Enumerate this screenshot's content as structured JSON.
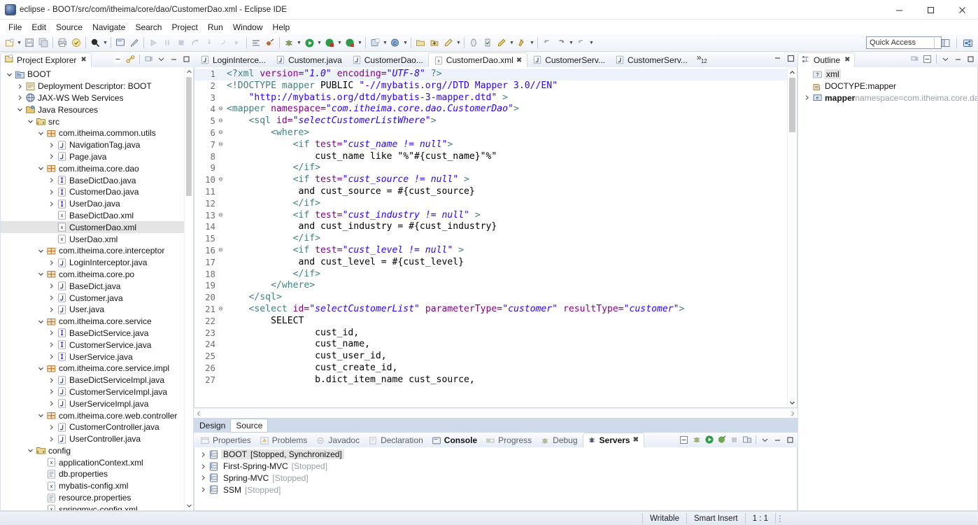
{
  "window": {
    "title": "eclipse - BOOT/src/com/itheima/core/dao/CustomerDao.xml - Eclipse IDE",
    "minimize": "─",
    "maximize": "□",
    "close": "✕"
  },
  "menubar": {
    "items": [
      "File",
      "Edit",
      "Source",
      "Navigate",
      "Search",
      "Project",
      "Run",
      "Window",
      "Help"
    ]
  },
  "toolbar": {
    "quick_access": "Quick Access"
  },
  "project_explorer": {
    "title": "Project Explorer",
    "close_mark": "✖",
    "tree": [
      {
        "indent": 0,
        "twisty": "down",
        "icon": "project-icon",
        "label": "BOOT",
        "selected": false
      },
      {
        "indent": 1,
        "twisty": "right",
        "icon": "deployment-icon",
        "label": "Deployment Descriptor: BOOT",
        "selected": false
      },
      {
        "indent": 1,
        "twisty": "right",
        "icon": "webservice-icon",
        "label": "JAX-WS Web Services",
        "selected": false
      },
      {
        "indent": 1,
        "twisty": "down",
        "icon": "javaresources-icon",
        "label": "Java Resources",
        "selected": false
      },
      {
        "indent": 2,
        "twisty": "down",
        "icon": "sourcefolder-icon",
        "label": "src",
        "selected": false
      },
      {
        "indent": 3,
        "twisty": "down",
        "icon": "package-icon",
        "label": "com.itheima.common.utils",
        "selected": false
      },
      {
        "indent": 4,
        "twisty": "right",
        "icon": "java-class-icon",
        "label": "NavigationTag.java",
        "selected": false
      },
      {
        "indent": 4,
        "twisty": "right",
        "icon": "java-class-icon",
        "label": "Page.java",
        "selected": false
      },
      {
        "indent": 3,
        "twisty": "down",
        "icon": "package-icon",
        "label": "com.itheima.core.dao",
        "selected": false
      },
      {
        "indent": 4,
        "twisty": "right",
        "icon": "java-interface-icon",
        "label": "BaseDictDao.java",
        "selected": false
      },
      {
        "indent": 4,
        "twisty": "right",
        "icon": "java-interface-icon",
        "label": "CustomerDao.java",
        "selected": false
      },
      {
        "indent": 4,
        "twisty": "right",
        "icon": "java-interface-icon",
        "label": "UserDao.java",
        "selected": false
      },
      {
        "indent": 4,
        "twisty": "none",
        "icon": "xml-file-icon",
        "label": "BaseDictDao.xml",
        "selected": false
      },
      {
        "indent": 4,
        "twisty": "none",
        "icon": "xml-file-icon",
        "label": "CustomerDao.xml",
        "selected": true
      },
      {
        "indent": 4,
        "twisty": "none",
        "icon": "xml-file-icon",
        "label": "UserDao.xml",
        "selected": false
      },
      {
        "indent": 3,
        "twisty": "down",
        "icon": "package-icon",
        "label": "com.itheima.core.interceptor",
        "selected": false
      },
      {
        "indent": 4,
        "twisty": "right",
        "icon": "java-class-icon",
        "label": "LoginInterceptor.java",
        "selected": false
      },
      {
        "indent": 3,
        "twisty": "down",
        "icon": "package-icon",
        "label": "com.itheima.core.po",
        "selected": false
      },
      {
        "indent": 4,
        "twisty": "right",
        "icon": "java-class-icon",
        "label": "BaseDict.java",
        "selected": false
      },
      {
        "indent": 4,
        "twisty": "right",
        "icon": "java-class-icon",
        "label": "Customer.java",
        "selected": false
      },
      {
        "indent": 4,
        "twisty": "right",
        "icon": "java-class-icon",
        "label": "User.java",
        "selected": false
      },
      {
        "indent": 3,
        "twisty": "down",
        "icon": "package-icon",
        "label": "com.itheima.core.service",
        "selected": false
      },
      {
        "indent": 4,
        "twisty": "right",
        "icon": "java-interface-icon",
        "label": "BaseDictService.java",
        "selected": false
      },
      {
        "indent": 4,
        "twisty": "right",
        "icon": "java-interface-icon",
        "label": "CustomerService.java",
        "selected": false
      },
      {
        "indent": 4,
        "twisty": "right",
        "icon": "java-interface-icon",
        "label": "UserService.java",
        "selected": false
      },
      {
        "indent": 3,
        "twisty": "down",
        "icon": "package-icon",
        "label": "com.itheima.core.service.impl",
        "selected": false
      },
      {
        "indent": 4,
        "twisty": "right",
        "icon": "java-class-icon",
        "label": "BaseDictServiceImpl.java",
        "selected": false
      },
      {
        "indent": 4,
        "twisty": "right",
        "icon": "java-class-icon",
        "label": "CustomerServiceImpl.java",
        "selected": false
      },
      {
        "indent": 4,
        "twisty": "right",
        "icon": "java-class-icon",
        "label": "UserServiceImpl.java",
        "selected": false
      },
      {
        "indent": 3,
        "twisty": "down",
        "icon": "package-icon",
        "label": "com.itheima.core.web.controller",
        "selected": false
      },
      {
        "indent": 4,
        "twisty": "right",
        "icon": "java-class-icon",
        "label": "CustomerController.java",
        "selected": false
      },
      {
        "indent": 4,
        "twisty": "right",
        "icon": "java-class-icon",
        "label": "UserController.java",
        "selected": false
      },
      {
        "indent": 2,
        "twisty": "down",
        "icon": "sourcefolder-icon",
        "label": "config",
        "selected": false
      },
      {
        "indent": 3,
        "twisty": "none",
        "icon": "xml-file-icon",
        "label": "applicationContext.xml",
        "selected": false
      },
      {
        "indent": 3,
        "twisty": "none",
        "icon": "properties-file-icon",
        "label": "db.properties",
        "selected": false
      },
      {
        "indent": 3,
        "twisty": "none",
        "icon": "xml-file-icon",
        "label": "mybatis-config.xml",
        "selected": false
      },
      {
        "indent": 3,
        "twisty": "none",
        "icon": "properties-file-icon",
        "label": "resource.properties",
        "selected": false
      },
      {
        "indent": 3,
        "twisty": "none",
        "icon": "xml-file-icon",
        "label": "springmvc-config.xml",
        "selected": false
      }
    ]
  },
  "editor": {
    "tabs": [
      {
        "label": "LoginIntercе...",
        "icon": "java-class-icon",
        "active": false
      },
      {
        "label": "Customer.java",
        "icon": "java-class-icon",
        "active": false
      },
      {
        "label": "CustomerDao...",
        "icon": "java-class-icon",
        "active": false
      },
      {
        "label": "CustomerDao.xml",
        "icon": "xml-file-icon",
        "active": true
      },
      {
        "label": "CustomerServ...",
        "icon": "java-class-icon",
        "active": false
      },
      {
        "label": "CustomerServ...",
        "icon": "java-class-icon",
        "active": false
      }
    ],
    "overflow_symbol": "»",
    "overflow_count": "12",
    "close_mark": "✖",
    "bottom_tabs": [
      {
        "label": "Design",
        "active": false
      },
      {
        "label": "Source",
        "active": true
      }
    ],
    "lines": [
      {
        "n": "1",
        "fold": "",
        "current": true,
        "parts": [
          {
            "t": "<?xml ",
            "c": "k-pi"
          },
          {
            "t": "version=",
            "c": "k-attr"
          },
          {
            "t": "\"1.0\"",
            "c": "k-str"
          },
          {
            "t": " ",
            "c": "k-txt"
          },
          {
            "t": "encoding=",
            "c": "k-attr"
          },
          {
            "t": "\"UTF-8\"",
            "c": "k-str"
          },
          {
            "t": " ?>",
            "c": "k-pi"
          }
        ]
      },
      {
        "n": "2",
        "fold": "",
        "parts": [
          {
            "t": "<!DOCTYPE mapper ",
            "c": "k-doct"
          },
          {
            "t": "PUBLIC ",
            "c": "k-txt"
          },
          {
            "t": "\"-//mybatis.org//DTD Mapper 3.0//EN\"",
            "c": "k-strp"
          }
        ]
      },
      {
        "n": "3",
        "fold": "",
        "parts": [
          {
            "t": "    ",
            "c": "k-txt"
          },
          {
            "t": "\"http://mybatis.org/dtd/mybatis-3-mapper.dtd\"",
            "c": "k-strp"
          },
          {
            "t": " >",
            "c": "k-doct"
          }
        ]
      },
      {
        "n": "4",
        "fold": "⊖",
        "parts": [
          {
            "t": "<mapper ",
            "c": "k-tag"
          },
          {
            "t": "namespace=",
            "c": "k-attr"
          },
          {
            "t": "\"com.itheima.core.dao.CustomerDao\"",
            "c": "k-str"
          },
          {
            "t": ">",
            "c": "k-tag"
          }
        ]
      },
      {
        "n": "5",
        "fold": "⊖",
        "parts": [
          {
            "t": "    <sql ",
            "c": "k-tag"
          },
          {
            "t": "id=",
            "c": "k-attr"
          },
          {
            "t": "\"selectCustomerListWhere\"",
            "c": "k-str"
          },
          {
            "t": ">",
            "c": "k-tag"
          }
        ]
      },
      {
        "n": "6",
        "fold": "⊖",
        "parts": [
          {
            "t": "        <where>",
            "c": "k-tag"
          }
        ]
      },
      {
        "n": "7",
        "fold": "⊖",
        "parts": [
          {
            "t": "            <if ",
            "c": "k-tag"
          },
          {
            "t": "test=",
            "c": "k-attr"
          },
          {
            "t": "\"cust_name != null\"",
            "c": "k-str"
          },
          {
            "t": ">",
            "c": "k-tag"
          }
        ]
      },
      {
        "n": "8",
        "fold": "",
        "parts": [
          {
            "t": "                cust_name like \"%\"#{cust_name}\"%\"",
            "c": "k-txt"
          }
        ]
      },
      {
        "n": "9",
        "fold": "",
        "parts": [
          {
            "t": "            </if>",
            "c": "k-tag"
          }
        ]
      },
      {
        "n": "10",
        "fold": "⊖",
        "parts": [
          {
            "t": "            <if ",
            "c": "k-tag"
          },
          {
            "t": "test=",
            "c": "k-attr"
          },
          {
            "t": "\"cust_source != null\"",
            "c": "k-str"
          },
          {
            "t": " >",
            "c": "k-tag"
          }
        ]
      },
      {
        "n": "11",
        "fold": "",
        "parts": [
          {
            "t": "             and cust_source = #{cust_source}",
            "c": "k-txt"
          }
        ]
      },
      {
        "n": "12",
        "fold": "",
        "parts": [
          {
            "t": "            </if>",
            "c": "k-tag"
          }
        ]
      },
      {
        "n": "13",
        "fold": "⊖",
        "parts": [
          {
            "t": "            <if ",
            "c": "k-tag"
          },
          {
            "t": "test=",
            "c": "k-attr"
          },
          {
            "t": "\"cust_industry != null\"",
            "c": "k-str"
          },
          {
            "t": " >",
            "c": "k-tag"
          }
        ]
      },
      {
        "n": "14",
        "fold": "",
        "parts": [
          {
            "t": "             and cust_industry = #{cust_industry}",
            "c": "k-txt"
          }
        ]
      },
      {
        "n": "15",
        "fold": "",
        "parts": [
          {
            "t": "            </if>",
            "c": "k-tag"
          }
        ]
      },
      {
        "n": "16",
        "fold": "⊖",
        "parts": [
          {
            "t": "            <if ",
            "c": "k-tag"
          },
          {
            "t": "test=",
            "c": "k-attr"
          },
          {
            "t": "\"cust_level != null\"",
            "c": "k-str"
          },
          {
            "t": " >",
            "c": "k-tag"
          }
        ]
      },
      {
        "n": "17",
        "fold": "",
        "parts": [
          {
            "t": "             and cust_level = #{cust_level}",
            "c": "k-txt"
          }
        ]
      },
      {
        "n": "18",
        "fold": "",
        "parts": [
          {
            "t": "            </if>",
            "c": "k-tag"
          }
        ]
      },
      {
        "n": "19",
        "fold": "",
        "parts": [
          {
            "t": "        </where>",
            "c": "k-tag"
          }
        ]
      },
      {
        "n": "20",
        "fold": "",
        "parts": [
          {
            "t": "    </sql>",
            "c": "k-tag"
          }
        ]
      },
      {
        "n": "21",
        "fold": "⊖",
        "parts": [
          {
            "t": "    <select ",
            "c": "k-tag"
          },
          {
            "t": "id=",
            "c": "k-attr"
          },
          {
            "t": "\"selectCustomerList\"",
            "c": "k-str"
          },
          {
            "t": " ",
            "c": "k-txt"
          },
          {
            "t": "parameterType=",
            "c": "k-attr"
          },
          {
            "t": "\"customer\"",
            "c": "k-str"
          },
          {
            "t": " ",
            "c": "k-txt"
          },
          {
            "t": "resultType=",
            "c": "k-attr"
          },
          {
            "t": "\"customer\"",
            "c": "k-str"
          },
          {
            "t": ">",
            "c": "k-tag"
          }
        ]
      },
      {
        "n": "22",
        "fold": "",
        "parts": [
          {
            "t": "        SELECT",
            "c": "k-txt"
          }
        ]
      },
      {
        "n": "23",
        "fold": "",
        "parts": [
          {
            "t": "                cust_id,",
            "c": "k-txt"
          }
        ]
      },
      {
        "n": "24",
        "fold": "",
        "parts": [
          {
            "t": "                cust_name,",
            "c": "k-txt"
          }
        ]
      },
      {
        "n": "25",
        "fold": "",
        "parts": [
          {
            "t": "                cust_user_id,",
            "c": "k-txt"
          }
        ]
      },
      {
        "n": "26",
        "fold": "",
        "parts": [
          {
            "t": "                cust_create_id,",
            "c": "k-txt"
          }
        ]
      },
      {
        "n": "27",
        "fold": "",
        "parts": [
          {
            "t": "                b.dict_item_name cust_source,",
            "c": "k-txt"
          }
        ]
      }
    ]
  },
  "outline": {
    "title": "Outline",
    "close_mark": "✖",
    "items": [
      {
        "indent": 0,
        "twisty": "none",
        "icon": "pi-icon",
        "label": "xml",
        "detail": "",
        "selected": true
      },
      {
        "indent": 0,
        "twisty": "none",
        "icon": "doctype-icon",
        "label": "DOCTYPE:mapper",
        "detail": "",
        "selected": false
      },
      {
        "indent": 0,
        "twisty": "right",
        "icon": "element-icon",
        "label": "mapper",
        "detail": " namespace=com.itheima.core.da",
        "selected": false
      }
    ]
  },
  "bottom_panel": {
    "tabs": [
      {
        "label": "Properties",
        "icon": "properties-icon",
        "state": "dim"
      },
      {
        "label": "Problems",
        "icon": "problems-icon",
        "state": "dim"
      },
      {
        "label": "Javadoc",
        "icon": "javadoc-icon",
        "state": "dim"
      },
      {
        "label": "Declaration",
        "icon": "declaration-icon",
        "state": "dim"
      },
      {
        "label": "Console",
        "icon": "console-icon",
        "state": "bold"
      },
      {
        "label": "Progress",
        "icon": "progress-icon",
        "state": "dim"
      },
      {
        "label": "Debug",
        "icon": "debug-icon",
        "state": "dim"
      },
      {
        "label": "Servers",
        "icon": "servers-icon",
        "state": "active"
      }
    ],
    "close_mark": "✖",
    "servers": [
      {
        "name": "BOOT",
        "status": "[Stopped, Synchronized]",
        "selected": true
      },
      {
        "name": "First-Spring-MVC",
        "status": "[Stopped]",
        "selected": false
      },
      {
        "name": "Spring-MVC",
        "status": "[Stopped]",
        "selected": false
      },
      {
        "name": "SSM",
        "status": "[Stopped]",
        "selected": false
      }
    ]
  },
  "statusbar": {
    "writable": "Writable",
    "insert_mode": "Smart Insert",
    "position": "1 : 1"
  }
}
